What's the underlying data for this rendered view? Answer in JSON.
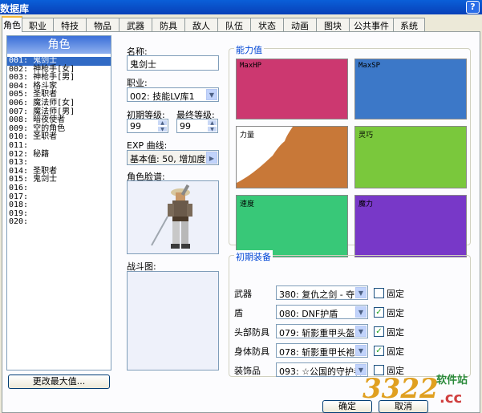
{
  "window": {
    "title": "数据库",
    "help": "?"
  },
  "tabs": [
    "角色",
    "职业",
    "特技",
    "物品",
    "武器",
    "防具",
    "敌人",
    "队伍",
    "状态",
    "动画",
    "图块",
    "公共事件",
    "系统"
  ],
  "list": {
    "header": "角色",
    "items": [
      "001: 鬼剑士",
      "002: 神枪手[女]",
      "003: 神枪手[男]",
      "004: 格斗家",
      "005: 圣职者",
      "006: 魔法师[女]",
      "007: 魔法师[男]",
      "008: 暗夜使者",
      "009: 空的角色",
      "010: 圣职者",
      "011:",
      "012: 秘籍",
      "013:",
      "014: 圣职者",
      "015: 鬼剑士",
      "016:",
      "017:",
      "018:",
      "019:",
      "020:"
    ],
    "selected_index": 0,
    "change_max_button": "更改最大值..."
  },
  "form": {
    "name_label": "名称:",
    "name_value": "鬼剑士",
    "class_label": "职业:",
    "class_value": "002: 技能LV库1",
    "initial_level_label": "初期等级:",
    "initial_level_value": "99",
    "final_level_label": "最终等级:",
    "final_level_value": "99",
    "exp_label": "EXP 曲线:",
    "exp_value": "基本值: 50, 增加度",
    "graphic_label": "角色脸谱:",
    "battle_label": "战斗图:"
  },
  "stats": {
    "title": "能力值",
    "items": [
      {
        "label": "MaxHP",
        "color": "#cc3870"
      },
      {
        "label": "MaxSP",
        "color": "#3c78c8"
      },
      {
        "label": "力量",
        "color": "#c87838"
      },
      {
        "label": "灵巧",
        "color": "#7ac83c"
      },
      {
        "label": "速度",
        "color": "#38c878"
      },
      {
        "label": "魔力",
        "color": "#7838c8"
      }
    ]
  },
  "equipment": {
    "title": "初期装备",
    "fixed_label": "固定",
    "rows": [
      {
        "label": "武器",
        "value": "380: 复仇之剑 - 夺",
        "fixed": false
      },
      {
        "label": "盾",
        "value": "080: DNF护盾",
        "fixed": true
      },
      {
        "label": "头部防具",
        "value": "079: 斩影重甲头盔",
        "fixed": true
      },
      {
        "label": "身体防具",
        "value": "078: 斩影重甲长袍",
        "fixed": true
      },
      {
        "label": "装饰品",
        "value": "093: ☆公国的守护者",
        "fixed": false
      }
    ]
  },
  "buttons": {
    "ok": "确定",
    "cancel": "取消"
  },
  "watermark": {
    "number": "3322",
    "text": "软件站",
    "domain": ".cc"
  }
}
